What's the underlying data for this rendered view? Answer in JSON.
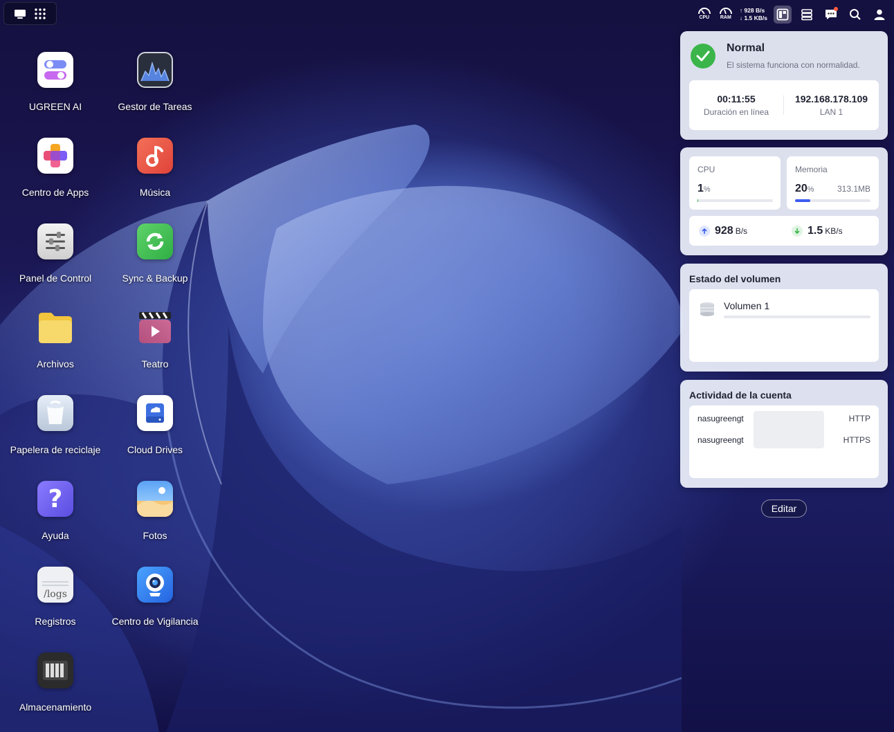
{
  "topbar": {
    "cpu_label": "CPU",
    "ram_label": "RAM",
    "upload_speed": "928 B/s",
    "download_speed": "1.5 KB/s"
  },
  "desktop": {
    "apps": [
      {
        "label": "UGREEN AI",
        "icon": "ugreen-ai-icon"
      },
      {
        "label": "Gestor de Tareas",
        "icon": "task-manager-icon"
      },
      {
        "label": "Centro de Apps",
        "icon": "app-center-icon"
      },
      {
        "label": "Música",
        "icon": "music-icon"
      },
      {
        "label": "Panel de Control",
        "icon": "control-panel-icon"
      },
      {
        "label": "Sync & Backup",
        "icon": "sync-backup-icon"
      },
      {
        "label": "Archivos",
        "icon": "files-icon"
      },
      {
        "label": "Teatro",
        "icon": "theater-icon"
      },
      {
        "label": "Papelera de reciclaje",
        "icon": "recycle-bin-icon"
      },
      {
        "label": "Cloud Drives",
        "icon": "cloud-drives-icon"
      },
      {
        "label": "Ayuda",
        "icon": "help-icon"
      },
      {
        "label": "Fotos",
        "icon": "photos-icon"
      },
      {
        "label": "Registros",
        "icon": "logs-icon"
      },
      {
        "label": "Centro de Vigilancia",
        "icon": "surveillance-icon"
      },
      {
        "label": "Almacenamiento",
        "icon": "storage-icon"
      }
    ],
    "logs_icon_text": "/logs"
  },
  "status_card": {
    "title": "Normal",
    "message": "El sistema funciona con normalidad.",
    "uptime": "00:11:55",
    "uptime_label": "Duración en línea",
    "ip": "192.168.178.109",
    "ip_label": "LAN 1",
    "status_color": "#3bb54a"
  },
  "resources_card": {
    "cpu_label": "CPU",
    "cpu_value": "1",
    "cpu_unit": "%",
    "cpu_percent": 1,
    "memory_label": "Memoria",
    "memory_value": "20",
    "memory_unit": "%",
    "memory_used": "313.1MB",
    "memory_percent": 20,
    "upload_value": "928",
    "upload_unit": "B/s",
    "download_value": "1.5",
    "download_unit": "KB/s"
  },
  "volume_card": {
    "title": "Estado del volumen",
    "volume_name": "Volumen 1"
  },
  "activity_card": {
    "title": "Actividad de la cuenta",
    "rows": [
      {
        "user": "nasugreengt",
        "protocol": "HTTP"
      },
      {
        "user": "nasugreengt",
        "protocol": "HTTPS"
      }
    ]
  },
  "edit_button": "Editar"
}
